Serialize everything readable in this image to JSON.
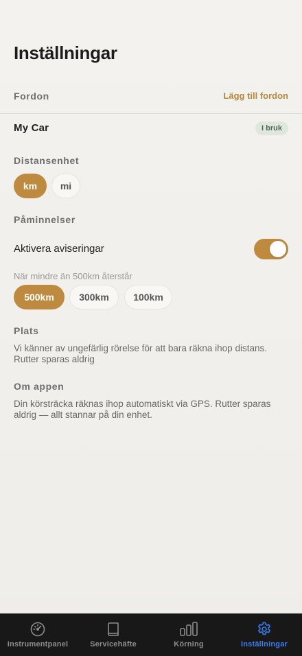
{
  "page": {
    "title": "Inställningar"
  },
  "vehicles": {
    "heading": "Fordon",
    "add_label": "Lägg till fordon",
    "item": {
      "name": "My Car",
      "badge": "I bruk"
    }
  },
  "distance_unit": {
    "heading": "Distansenhet",
    "options": [
      "km",
      "mi"
    ],
    "selected": "km"
  },
  "reminders": {
    "heading": "Påminnelser",
    "toggle_label": "Aktivera aviseringar",
    "toggle_on": true,
    "threshold_hint": "När mindre än 500km återstår",
    "options": [
      "500km",
      "300km",
      "100km"
    ],
    "selected": "500km"
  },
  "location": {
    "heading": "Plats",
    "text": "Vi känner av ungefärlig rörelse för att bara räkna ihop distans. Rutter sparas aldrig"
  },
  "about": {
    "heading": "Om appen",
    "text": "Din körsträcka räknas ihop automatiskt via GPS. Rutter sparas aldrig — allt stannar på din enhet."
  },
  "tabbar": {
    "items": [
      {
        "label": "Instrumentpanel",
        "icon": "speedometer-icon"
      },
      {
        "label": "Servicehäfte",
        "icon": "book-icon"
      },
      {
        "label": "Körning",
        "icon": "bar-chart-icon"
      },
      {
        "label": "Inställningar",
        "icon": "gear-icon"
      }
    ],
    "active": "Inställningar"
  },
  "colors": {
    "accent": "#bd8a3f",
    "accent_text": "#b5883b",
    "badge_bg": "#dfe6dc",
    "tab_active": "#3a7cf0",
    "tabbar_bg": "#181818"
  }
}
